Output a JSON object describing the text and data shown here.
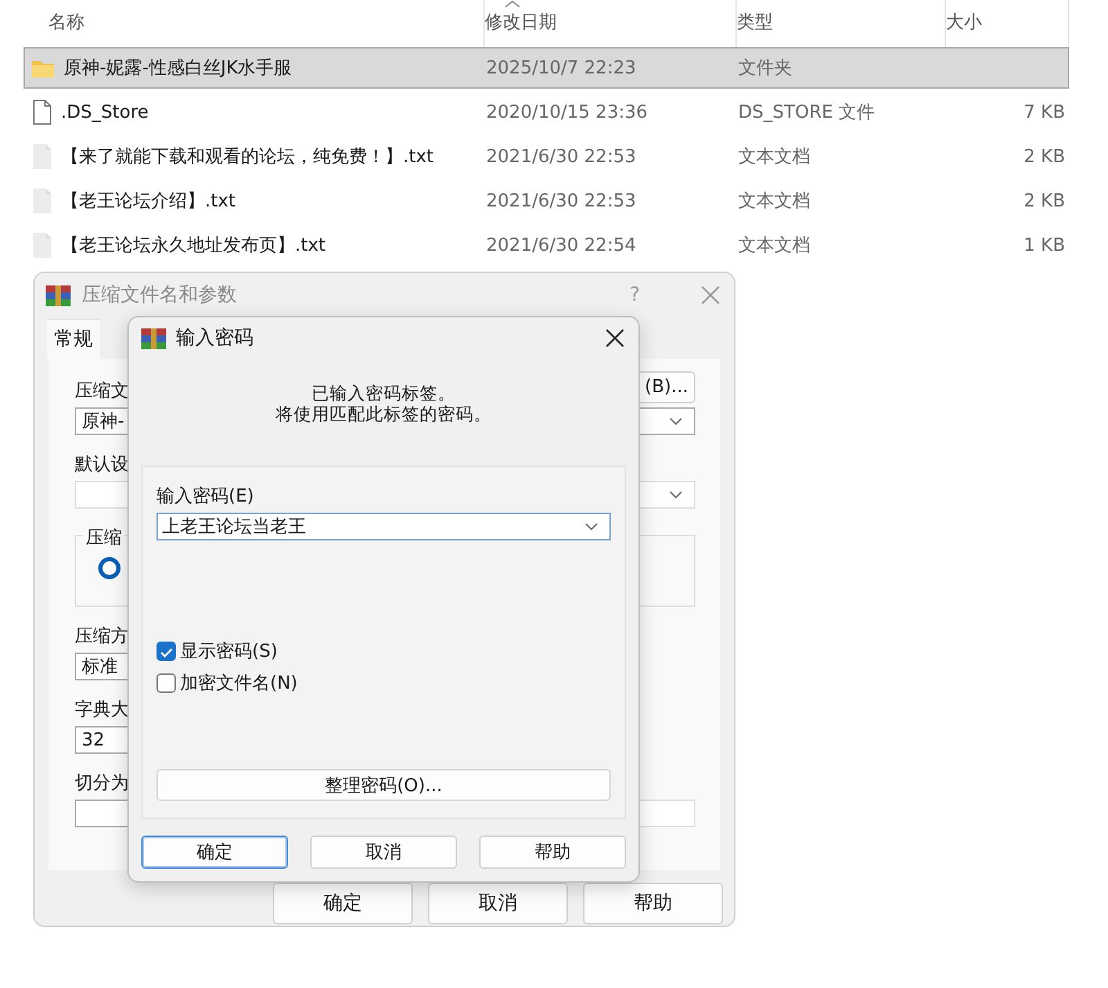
{
  "explorer": {
    "columns": [
      "名称",
      "修改日期",
      "类型",
      "大小"
    ],
    "rows": [
      {
        "kind": "folder",
        "name": "原神-妮露-性感白丝JK水手服",
        "modified": "2025/10/7 22:23",
        "type": "文件夹",
        "size": "",
        "selected": true
      },
      {
        "kind": "file",
        "name": ".DS_Store",
        "modified": "2020/10/15 23:36",
        "type": "DS_STORE 文件",
        "size": "7 KB",
        "selected": false
      },
      {
        "kind": "text",
        "name": "【来了就能下载和观看的论坛，纯免费！】.txt",
        "modified": "2021/6/30 22:53",
        "type": "文本文档",
        "size": "2 KB",
        "selected": false
      },
      {
        "kind": "text",
        "name": "【老王论坛介绍】.txt",
        "modified": "2021/6/30 22:53",
        "type": "文本文档",
        "size": "2 KB",
        "selected": false
      },
      {
        "kind": "text",
        "name": "【老王论坛永久地址发布页】.txt",
        "modified": "2021/6/30 22:54",
        "type": "文本文档",
        "size": "1 KB",
        "selected": false
      }
    ]
  },
  "archive_dialog": {
    "title": "压缩文件名和参数",
    "help": "?",
    "tabs": [
      {
        "label": "常规",
        "selected": true
      }
    ],
    "archive_name_label": "压缩文",
    "browse_button": "(B)...",
    "archive_name_value": "原神-",
    "profile_label": "默认设",
    "format_group_label": "压缩",
    "format_radio": {
      "selected": true
    },
    "method_label": "压缩方",
    "method_value": "标准",
    "dictionary_label": "字典大",
    "dictionary_value": "32",
    "split_label": "切分为",
    "buttons": [
      "确定",
      "取消",
      "帮助"
    ]
  },
  "password_dialog": {
    "title": "输入密码",
    "message": [
      "已输入密码标签。",
      "将使用匹配此标签的密码。"
    ],
    "password_label": "输入密码(E)",
    "password_value": "上老王论坛当老王",
    "checkboxes": [
      {
        "label": "显示密码(S)",
        "checked": true
      },
      {
        "label": "加密文件名(N)",
        "checked": false
      }
    ],
    "manage_button": "整理密码(O)...",
    "buttons": [
      {
        "label": "确定",
        "default": true
      },
      {
        "label": "取消",
        "default": false
      },
      {
        "label": "帮助",
        "default": false
      }
    ]
  }
}
